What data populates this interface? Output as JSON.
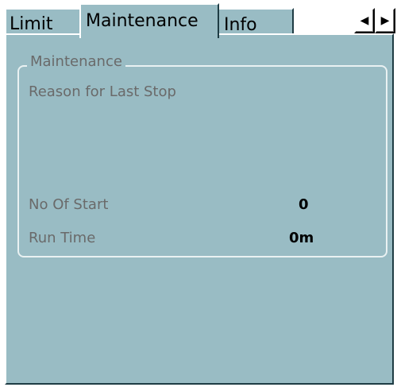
{
  "tabs": {
    "limit": "Limit",
    "maintenance": "Maintenance",
    "info": "Info",
    "active": "Maintenance"
  },
  "scroll": {
    "left_icon": "arrow-left-icon",
    "right_icon": "arrow-right-icon",
    "left_glyph": "◀",
    "right_glyph": "▶"
  },
  "maintenance": {
    "group_title": "Maintenance",
    "reason_label": "Reason for Last Stop",
    "reason_value": "",
    "no_of_start_label": "No Of Start",
    "no_of_start_value": "0",
    "run_time_label": "Run Time",
    "run_time_value": "0m"
  },
  "colors": {
    "panel": "#99bcc4",
    "label_text": "#6a6a6a",
    "group_border": "#e9f1f2"
  }
}
